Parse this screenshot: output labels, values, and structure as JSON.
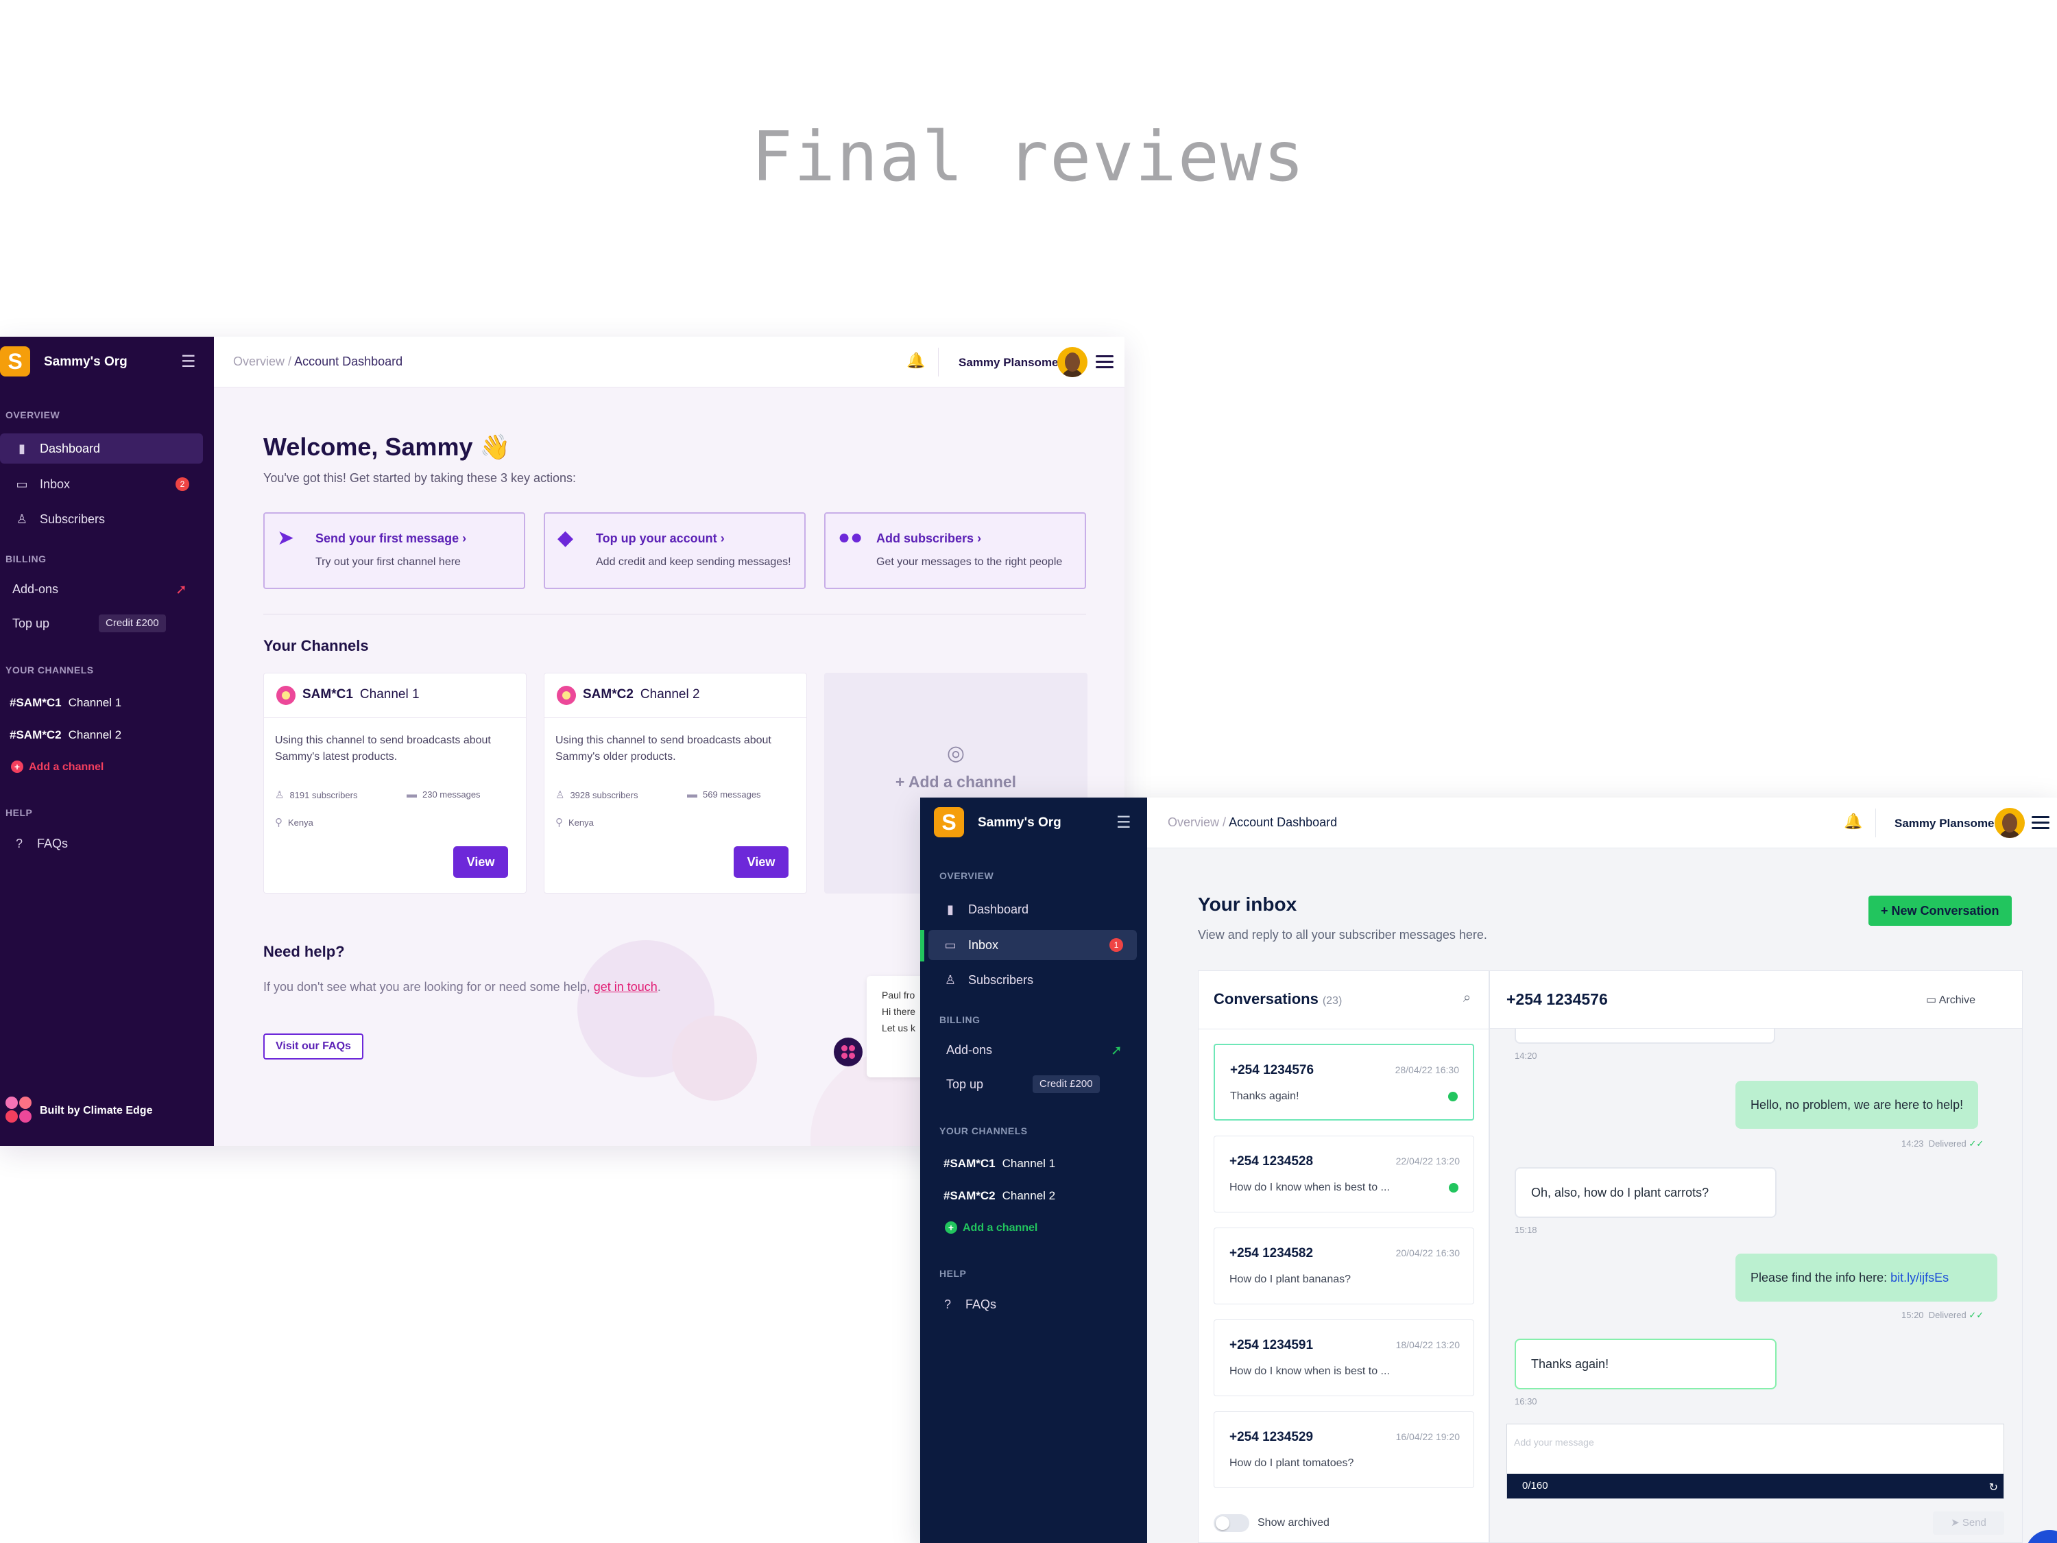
{
  "page_title": "Final reviews",
  "dashboard": {
    "org_name": "Sammy's Org",
    "org_initial": "S",
    "sections": {
      "overview": "OVERVIEW",
      "billing": "BILLING",
      "your_channels": "YOUR CHANNELS",
      "help": "HELP"
    },
    "nav": {
      "dashboard": "Dashboard",
      "inbox": "Inbox",
      "inbox_badge": "2",
      "subscribers": "Subscribers",
      "addons": "Add-ons",
      "topup": "Top up",
      "credit": "Credit £200",
      "faqs": "FAQs"
    },
    "channels": [
      {
        "code": "#SAM*C1",
        "name": "Channel 1"
      },
      {
        "code": "#SAM*C2",
        "name": "Channel 2"
      }
    ],
    "add_channel": "Add a channel",
    "built_by": "Built by Climate Edge",
    "breadcrumb": {
      "root": "Overview",
      "sep": "/",
      "current": "Account Dashboard"
    },
    "user_name": "Sammy Plansome",
    "welcome": "Welcome, Sammy 👋",
    "welcome_sub": "You've got this! Get started by taking these 3 key actions:",
    "actions": [
      {
        "title": "Send your first message",
        "sub": "Try out your first channel here"
      },
      {
        "title": "Top up your account",
        "sub": "Add credit and keep sending messages!"
      },
      {
        "title": "Add subscribers",
        "sub": "Get your messages to the right people"
      }
    ],
    "your_channels_title": "Your Channels",
    "channel_cards": [
      {
        "code": "SAM*C1",
        "name": "Channel 1",
        "desc": "Using this channel to send broadcasts about Sammy's latest products.",
        "subscribers": "8191 subscribers",
        "messages": "230 messages",
        "location": "Kenya",
        "button": "View"
      },
      {
        "code": "SAM*C2",
        "name": "Channel 2",
        "desc": "Using this channel to send broadcasts about Sammy's older products.",
        "subscribers": "3928 subscribers",
        "messages": "569 messages",
        "location": "Kenya",
        "button": "View"
      }
    ],
    "add_channel_card": "+ Add a channel",
    "need_help_title": "Need help?",
    "help_text": "If you don't see what you are looking for or need some help,",
    "help_link": "get in touch",
    "help_button": "Visit our FAQs",
    "chat_preview": [
      "Paul fro",
      "Hi there",
      "Let us k"
    ]
  },
  "inbox": {
    "org_name": "Sammy's Org",
    "org_initial": "S",
    "sections": {
      "overview": "OVERVIEW",
      "billing": "BILLING",
      "your_channels": "YOUR CHANNELS",
      "help": "HELP"
    },
    "nav": {
      "dashboard": "Dashboard",
      "inbox": "Inbox",
      "inbox_badge": "1",
      "subscribers": "Subscribers",
      "addons": "Add-ons",
      "topup": "Top up",
      "credit": "Credit £200",
      "faqs": "FAQs"
    },
    "channels": [
      {
        "code": "#SAM*C1",
        "name": "Channel 1"
      },
      {
        "code": "#SAM*C2",
        "name": "Channel 2"
      }
    ],
    "add_channel": "Add a channel",
    "breadcrumb": {
      "root": "Overview",
      "sep": "/",
      "current": "Account Dashboard"
    },
    "user_name": "Sammy Plansome",
    "title": "Your inbox",
    "subtitle": "View and reply to all your subscriber messages here.",
    "new_conversation": "New Conversation",
    "conversations_label": "Conversations",
    "conversations_count": "(23)",
    "conversations": [
      {
        "number": "+254 1234576",
        "date": "28/04/22 16:30",
        "preview": "Thanks again!",
        "unread": true,
        "selected": true
      },
      {
        "number": "+254 1234528",
        "date": "22/04/22 13:20",
        "preview": "How do I know when is best to ...",
        "unread": true,
        "selected": false
      },
      {
        "number": "+254 1234582",
        "date": "20/04/22 16:30",
        "preview": "How do I plant bananas?",
        "unread": false,
        "selected": false
      },
      {
        "number": "+254 1234591",
        "date": "18/04/22 13:20",
        "preview": "How do I know when is best to ...",
        "unread": false,
        "selected": false
      },
      {
        "number": "+254 1234529",
        "date": "16/04/22 19:20",
        "preview": "How do I plant tomatoes?",
        "unread": false,
        "selected": false
      }
    ],
    "show_archived": "Show archived",
    "chat_number": "+254 1234576",
    "archive": "Archive",
    "messages": [
      {
        "dir": "time-only",
        "time": "14:20"
      },
      {
        "dir": "out",
        "text": "Hello, no problem, we are here to help!",
        "time": "14:23",
        "status": "Delivered"
      },
      {
        "dir": "in",
        "text": "Oh, also, how do I plant carrots?",
        "time": "15:18"
      },
      {
        "dir": "out",
        "text": "Please find the info here:",
        "link": "bit.ly/ijfsEs",
        "time": "15:20",
        "status": "Delivered"
      },
      {
        "dir": "in",
        "text": "Thanks again!",
        "time": "16:30"
      }
    ],
    "composer_placeholder": "Add your message",
    "char_counter": "0/160",
    "send": "Send"
  }
}
